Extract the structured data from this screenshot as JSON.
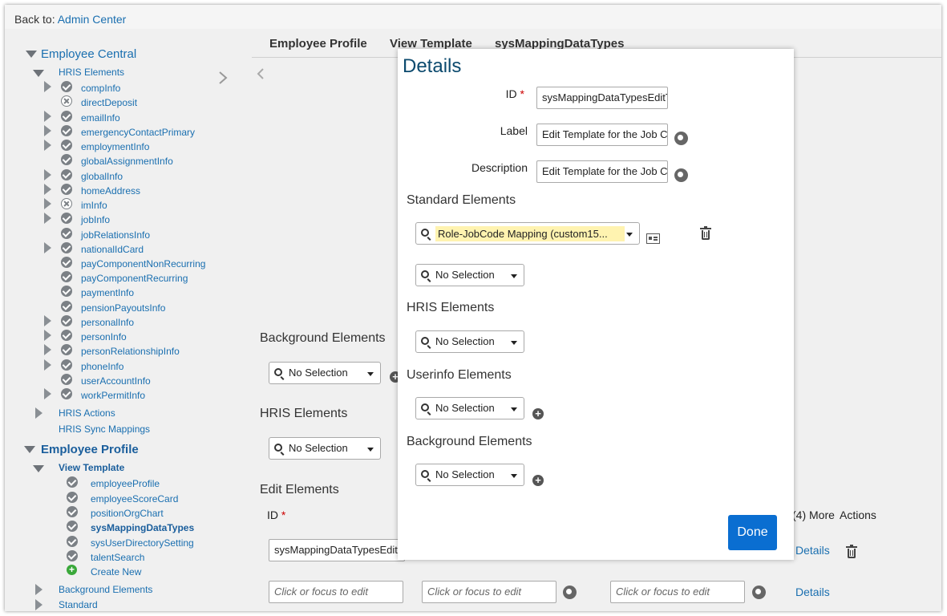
{
  "topbar": {
    "back_prefix": "Back to:",
    "back_link": "Admin Center"
  },
  "sidebar": {
    "employee_central": "Employee Central",
    "hris_elements": "HRIS Elements",
    "hris_items": [
      {
        "label": "compInfo"
      },
      {
        "label": "directDeposit"
      },
      {
        "label": "emailInfo"
      },
      {
        "label": "emergencyContactPrimary"
      },
      {
        "label": "employmentInfo"
      },
      {
        "label": "globalAssignmentInfo"
      },
      {
        "label": "globalInfo"
      },
      {
        "label": "homeAddress"
      },
      {
        "label": "imInfo"
      },
      {
        "label": "jobInfo"
      },
      {
        "label": "jobRelationsInfo"
      },
      {
        "label": "nationalIdCard"
      },
      {
        "label": "payComponentNonRecurring"
      },
      {
        "label": "payComponentRecurring"
      },
      {
        "label": "paymentInfo"
      },
      {
        "label": "pensionPayoutsInfo"
      },
      {
        "label": "personalInfo"
      },
      {
        "label": "personInfo"
      },
      {
        "label": "personRelationshipInfo"
      },
      {
        "label": "phoneInfo"
      },
      {
        "label": "userAccountInfo"
      },
      {
        "label": "workPermitInfo"
      }
    ],
    "hris_actions": "HRIS Actions",
    "hris_sync": "HRIS Sync Mappings",
    "employee_profile": "Employee Profile",
    "view_template": "View Template",
    "template_items": [
      {
        "label": "employeeProfile"
      },
      {
        "label": "employeeScoreCard"
      },
      {
        "label": "positionOrgChart"
      },
      {
        "label": "sysMappingDataTypes"
      },
      {
        "label": "sysUserDirectorySetting"
      },
      {
        "label": "talentSearch"
      },
      {
        "label": "Create New"
      }
    ],
    "background_elements": "Background Elements",
    "standard": "Standard"
  },
  "main": {
    "tabs": [
      {
        "label": "Employee Profile"
      },
      {
        "label": "View Template"
      },
      {
        "label": "sysMappingDataTypes"
      }
    ],
    "background_heading": "Background Elements",
    "hris_heading": "HRIS Elements",
    "edit_heading": "Edit Elements",
    "id_label": "ID",
    "more_label": "(4) More",
    "actions_label": "Actions",
    "no_selection": "No Selection",
    "row1": {
      "id_value": "sysMappingDataTypesEdit",
      "details": "Details"
    },
    "row2": {
      "placeholder": "Click or focus to edit",
      "details": "Details"
    }
  },
  "dialog": {
    "title": "Details",
    "id_label": "ID",
    "id_value": "sysMappingDataTypesEditT",
    "label_label": "Label",
    "label_value": "Edit Template for the Job C",
    "description_label": "Description",
    "description_value": "Edit Template for the Job C",
    "standard_heading": "Standard Elements",
    "standard_selected": "Role-JobCode Mapping (custom15...",
    "no_selection": "No Selection",
    "hris_heading": "HRIS Elements",
    "userinfo_heading": "Userinfo Elements",
    "background_heading": "Background Elements",
    "done_label": "Done"
  },
  "colors": {
    "link": "#1a6fb0",
    "accent": "#0a6ed1",
    "title": "#0c4a6e",
    "highlight": "#fff3b0"
  }
}
